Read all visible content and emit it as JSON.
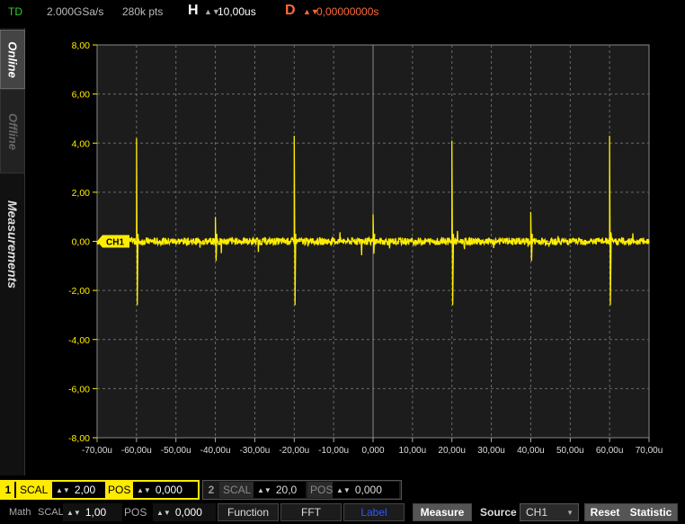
{
  "topbar": {
    "mode": "TD",
    "sample_rate": "2.000GSa/s",
    "points": "280k pts",
    "h_label": "H",
    "h_value": "10,00us",
    "d_label": "D",
    "d_value": "0,00000000s"
  },
  "sidebar": {
    "tabs": [
      "Online",
      "Offline",
      "Measurements"
    ]
  },
  "colors": {
    "trace": "#ffee00",
    "grid": "#6a6a6a",
    "plot_bg": "#1c1c1c",
    "delay": "#ff6a3a",
    "mode": "#2ecc2e"
  },
  "chart_data": {
    "type": "line",
    "xlim": [
      -70,
      70
    ],
    "ylim": [
      -8,
      8
    ],
    "x_ticks": [
      "-70,00u",
      "-60,00u",
      "-50,00u",
      "-40,00u",
      "-30,00u",
      "-20,00u",
      "-10,00u",
      "0,000",
      "10,00u",
      "20,00u",
      "30,00u",
      "40,00u",
      "50,00u",
      "60,00u",
      "70,00u"
    ],
    "y_ticks": [
      "8,00",
      "6,00",
      "4,00",
      "2,00",
      "0,00",
      "-2,00",
      "-4,00",
      "-6,00",
      "-8,00"
    ],
    "grid": true,
    "series": [
      {
        "name": "CH1",
        "baseline": 0.0,
        "noise_amplitude": 0.15,
        "spikes": [
          {
            "x": -60,
            "max": 4.2,
            "min": -2.6
          },
          {
            "x": -40,
            "max": 1.0,
            "min": -0.8
          },
          {
            "x": -20,
            "max": 4.3,
            "min": -2.6
          },
          {
            "x": 0,
            "max": 1.1,
            "min": -0.5
          },
          {
            "x": 20,
            "max": 4.1,
            "min": -2.6
          },
          {
            "x": 40,
            "max": 1.2,
            "min": -0.8
          },
          {
            "x": 60,
            "max": 4.3,
            "min": -2.6
          }
        ]
      }
    ]
  },
  "ch1": {
    "num": "1",
    "scal_label": "SCAL",
    "scal_value": "2,00",
    "pos_label": "POS",
    "pos_value": "0,000"
  },
  "ch2": {
    "num": "2",
    "scal_label": "SCAL",
    "scal_value": "20,0",
    "pos_label": "POS",
    "pos_value": "0,000"
  },
  "math": {
    "label": "Math",
    "scal_label": "SCAL",
    "scal_value": "1,00",
    "pos_label": "POS",
    "pos_value": "0,000"
  },
  "buttons": {
    "function": "Function",
    "fft": "FFT",
    "label": "Label",
    "measure": "Measure",
    "reset": "Reset",
    "statistic": "Statistic"
  },
  "source": {
    "label": "Source",
    "value": "CH1"
  }
}
